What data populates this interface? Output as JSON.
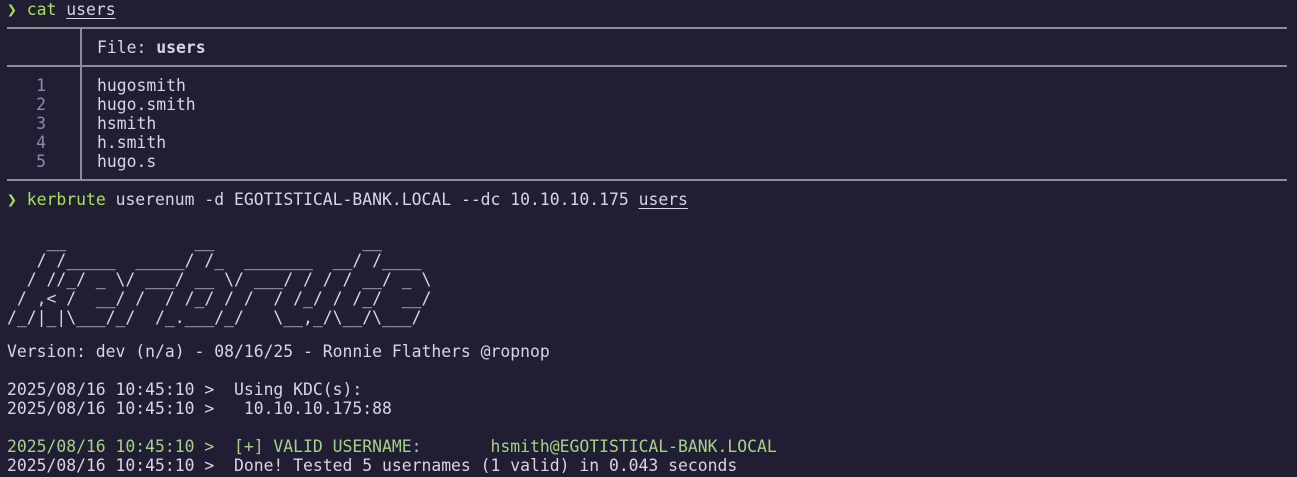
{
  "prompt_symbol": "❯",
  "cmd1": {
    "command": "cat",
    "argument": "users"
  },
  "bat": {
    "header_prefix": "File: ",
    "file_name": "users",
    "lines": [
      {
        "num": "1",
        "text": "hugosmith"
      },
      {
        "num": "2",
        "text": "hugo.smith"
      },
      {
        "num": "3",
        "text": "hsmith"
      },
      {
        "num": "4",
        "text": "h.smith"
      },
      {
        "num": "5",
        "text": "hugo.s"
      }
    ]
  },
  "cmd2": {
    "command": "kerbrute",
    "args": " userenum -d EGOTISTICAL-BANK.LOCAL --dc 10.10.10.175 ",
    "file_arg": "users"
  },
  "banner": "    __             __               __     \n   / /_____  _____/ /_  _______  __/ /____ \n  / //_/ _ \\/ ___/ __ \\/ ___/ / / / __/ _ \\\n / ,< /  __/ /  / /_/ / /  / /_/ / /_/  __/\n/_/|_|\\___/_/  /_.___/_/   \\__,_/\\__/\\___/ ",
  "version_line": "Version: dev (n/a) - 08/16/25 - Ronnie Flathers @ropnop",
  "log": {
    "l1": "2025/08/16 10:45:10 >  Using KDC(s):",
    "l2": "2025/08/16 10:45:10 >   10.10.10.175:88",
    "valid_prefix": "2025/08/16 10:45:10 >  [+] VALID USERNAME:       ",
    "valid_user": "hsmith@EGOTISTICAL-BANK.LOCAL",
    "done": "2025/08/16 10:45:10 >  Done! Tested 5 usernames (1 valid) in 0.043 seconds"
  },
  "colors": {
    "background": "#211e33",
    "prompt_green": "#a6e15a",
    "valid_green": "#a6d189",
    "rule_gray": "#8a8f95"
  }
}
